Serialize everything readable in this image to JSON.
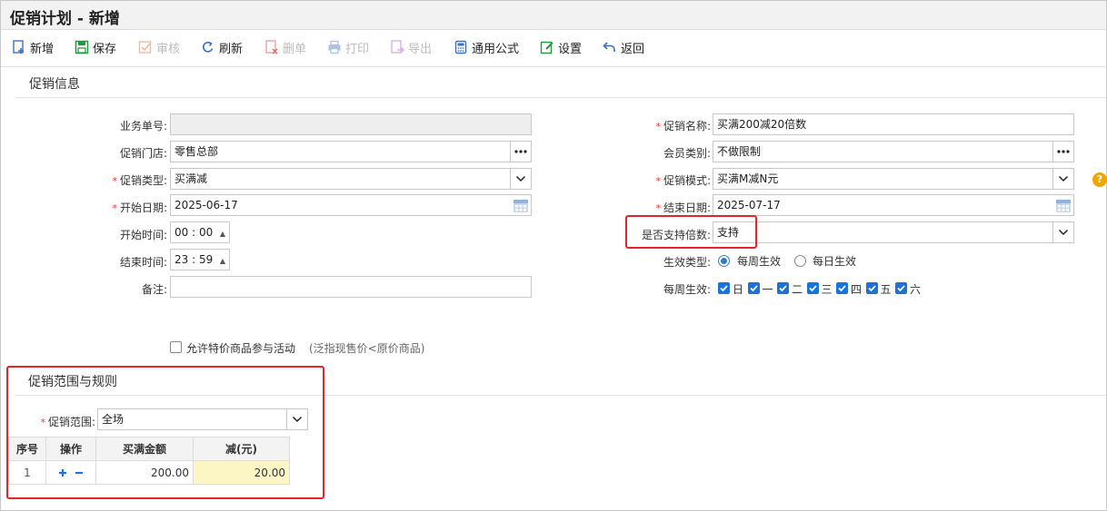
{
  "window": {
    "title": "促销计划 - 新增"
  },
  "toolbar": {
    "new": "新增",
    "save": "保存",
    "audit": "审核",
    "refresh": "刷新",
    "delete": "删单",
    "print": "打印",
    "export": "导出",
    "formula": "通用公式",
    "settings": "设置",
    "back": "返回"
  },
  "section_info": "促销信息",
  "form": {
    "bill_no_label": "业务单号:",
    "bill_no": "",
    "store_label": "促销门店:",
    "store": "零售总部",
    "promo_type_label": "促销类型:",
    "promo_type": "买满减",
    "start_date_label": "开始日期:",
    "start_date": "2025-06-17",
    "start_time_label": "开始时间:",
    "start_time_h": "00",
    "start_time_m": "00",
    "end_time_label": "结束时间:",
    "end_time_h": "23",
    "end_time_m": "59",
    "remark_label": "备注:",
    "remark": "",
    "promo_name_label": "促销名称:",
    "promo_name": "买满200减20倍数",
    "member_type_label": "会员类别:",
    "member_type": "不做限制",
    "promo_mode_label": "促销模式:",
    "promo_mode": "买满M减N元",
    "end_date_label": "结束日期:",
    "end_date": "2025-07-17",
    "multiple_label": "是否支持倍数:",
    "multiple": "支持",
    "effect_type_label": "生效类型:",
    "effect_weekly": "每周生效",
    "effect_daily": "每日生效",
    "weekly_label": "每周生效:",
    "weekdays": [
      "日",
      "一",
      "二",
      "三",
      "四",
      "五",
      "六"
    ],
    "allow_special_label": "允许特价商品参与活动",
    "allow_special_note": "(泛指现售价<原价商品)"
  },
  "section_rules": "促销范围与规则",
  "rules": {
    "scope_label": "促销范围:",
    "scope": "全场",
    "columns": [
      "序号",
      "操作",
      "买满金额",
      "减(元)"
    ],
    "rows": [
      {
        "index": "1",
        "amount": "200.00",
        "reduce": "20.00"
      }
    ]
  },
  "help_icon_text": "?",
  "colors": {
    "accent": "#1a73d9",
    "highlight_box": "#e0262b",
    "reduce_cell": "#fbf6c4",
    "help": "#f0a500"
  }
}
